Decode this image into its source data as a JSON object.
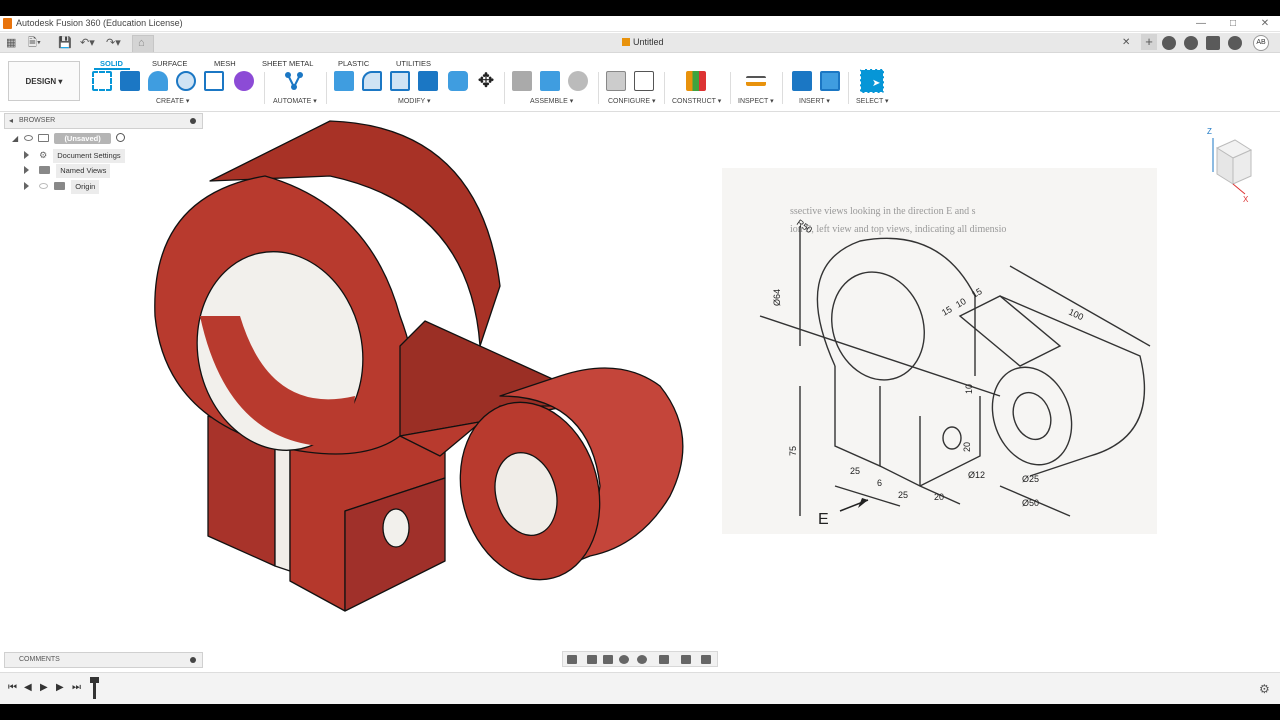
{
  "window": {
    "title": "Autodesk Fusion 360 (Education License)"
  },
  "document": {
    "title": "Untitled"
  },
  "user": {
    "initials": "AB"
  },
  "workspace": {
    "label": "DESIGN"
  },
  "tabs": [
    {
      "label": "SOLID",
      "active": true
    },
    {
      "label": "SURFACE"
    },
    {
      "label": "MESH"
    },
    {
      "label": "SHEET METAL"
    },
    {
      "label": "PLASTIC"
    },
    {
      "label": "UTILITIES"
    }
  ],
  "groups": [
    "CREATE",
    "AUTOMATE",
    "MODIFY",
    "ASSEMBLE",
    "CONFIGURE",
    "CONSTRUCT",
    "INSPECT",
    "INSERT",
    "SELECT"
  ],
  "browser": {
    "header": "BROWSER",
    "root": "(Unsaved)",
    "items": [
      "Document Settings",
      "Named Views",
      "Origin"
    ]
  },
  "comments": {
    "header": "COMMENTS"
  },
  "drawing": {
    "labels": [
      "R50",
      "Ø64",
      "15",
      "10",
      "15",
      "100",
      "10",
      "75",
      "20",
      "25",
      "6",
      "25",
      "20",
      "Ø12",
      "Ø25",
      "Ø50",
      "E"
    ],
    "text_lines": [
      "ssective views looking in the direction E and s",
      "ion E, left view and top views, indicating all dimensio"
    ]
  },
  "colors": {
    "accent": "#0696d7",
    "model": "#b5382c",
    "model_dark": "#8f2a20",
    "background": "#ffffff"
  }
}
